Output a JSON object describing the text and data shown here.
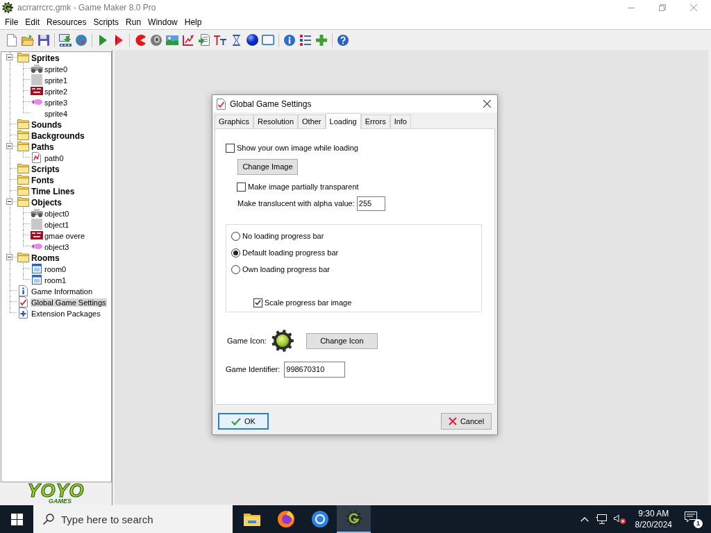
{
  "window": {
    "title": "acrrarrcrc.gmk - Game Maker 8.0 Pro"
  },
  "menu": [
    "File",
    "Edit",
    "Resources",
    "Scripts",
    "Run",
    "Window",
    "Help"
  ],
  "tree": [
    {
      "label": "Sprites",
      "kind": "folder",
      "selected": false,
      "expanded": true,
      "children": [
        {
          "label": "sprite0",
          "kind": "machine",
          "selected": false
        },
        {
          "label": "sprite1",
          "kind": "blank",
          "selected": false
        },
        {
          "label": "sprite2",
          "kind": "banner",
          "selected": false
        },
        {
          "label": "sprite3",
          "kind": "fish",
          "selected": false
        },
        {
          "label": "sprite4",
          "kind": "empty",
          "selected": false
        }
      ]
    },
    {
      "label": "Sounds",
      "kind": "folder",
      "selected": false
    },
    {
      "label": "Backgrounds",
      "kind": "folder",
      "selected": false
    },
    {
      "label": "Paths",
      "kind": "folder",
      "selected": false,
      "expanded": true,
      "children": [
        {
          "label": "path0",
          "kind": "path",
          "selected": false
        }
      ]
    },
    {
      "label": "Scripts",
      "kind": "folder",
      "selected": false
    },
    {
      "label": "Fonts",
      "kind": "folder",
      "selected": false
    },
    {
      "label": "Time Lines",
      "kind": "folder",
      "selected": false
    },
    {
      "label": "Objects",
      "kind": "folder",
      "selected": false,
      "expanded": true,
      "children": [
        {
          "label": "object0",
          "kind": "machine",
          "selected": false
        },
        {
          "label": "object1",
          "kind": "blank",
          "selected": false
        },
        {
          "label": "gmae overe",
          "kind": "banner",
          "selected": false
        },
        {
          "label": "object3",
          "kind": "fish",
          "selected": false
        }
      ]
    },
    {
      "label": "Rooms",
      "kind": "folder",
      "selected": false,
      "expanded": true,
      "children": [
        {
          "label": "room0",
          "kind": "room",
          "selected": false
        },
        {
          "label": "room1",
          "kind": "room",
          "selected": false
        }
      ]
    },
    {
      "label": "Game Information",
      "kind": "info",
      "selected": false
    },
    {
      "label": "Global Game Settings",
      "kind": "settings",
      "selected": true
    },
    {
      "label": "Extension Packages",
      "kind": "extension",
      "selected": false
    }
  ],
  "logo": {
    "wordmark": "YOYO",
    "tagline": "GAMES"
  },
  "dialog": {
    "title": "Global Game Settings",
    "tabs": [
      {
        "label": "Graphics",
        "selected": false
      },
      {
        "label": "Resolution",
        "selected": false
      },
      {
        "label": "Other",
        "selected": false
      },
      {
        "label": "Loading",
        "selected": true
      },
      {
        "label": "Errors",
        "selected": false
      },
      {
        "label": "Info",
        "selected": false
      }
    ],
    "show_image": {
      "label": "Show your own image while loading",
      "checked": false
    },
    "change_image": "Change Image",
    "transparent": {
      "label": "Make image partially transparent",
      "checked": false
    },
    "alpha": {
      "label": "Make translucent with alpha value:",
      "value": "255"
    },
    "progress_options": [
      {
        "label": "No loading progress bar",
        "selected": false
      },
      {
        "label": "Default loading progress bar",
        "selected": true
      },
      {
        "label": "Own loading progress bar",
        "selected": false
      }
    ],
    "scale": {
      "label": "Scale progress bar image",
      "checked": true
    },
    "icon_label": "Game Icon:",
    "change_icon": "Change Icon",
    "identifier": {
      "label": "Game Identifier:",
      "value": "998670310"
    },
    "ok": "OK",
    "cancel": "Cancel"
  },
  "taskbar": {
    "search": {
      "placeholder": "Type here to search"
    },
    "apps": [
      {
        "kind": "explorer",
        "active": false
      },
      {
        "kind": "firefox",
        "active": false
      },
      {
        "kind": "browser",
        "active": false
      },
      {
        "kind": "gamemaker",
        "active": true
      }
    ],
    "clock": {
      "time": "9:30 AM",
      "date": "8/20/2024"
    },
    "notifications": "1"
  }
}
